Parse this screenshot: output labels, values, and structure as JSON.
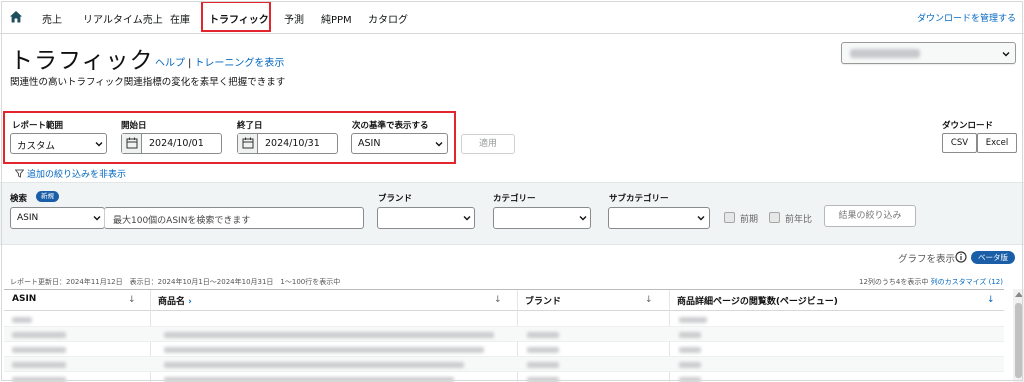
{
  "nav": {
    "items": [
      "売上",
      "リアルタイム売上",
      "在庫",
      "トラフィック",
      "予測",
      "純PPM",
      "カタログ"
    ],
    "active_index": 3,
    "manage_downloads": "ダウンロードを管理する"
  },
  "header": {
    "title": "トラフィック",
    "help_link": "ヘルプ",
    "separator": "|",
    "training_link": "トレーニングを表示",
    "subtitle": "関連性の高いトラフィック関連指標の変化を素早く把握できます"
  },
  "report": {
    "range_label": "レポート範囲",
    "range_value": "カスタム",
    "start_label": "開始日",
    "start_value": "2024/10/01",
    "end_label": "終了日",
    "end_value": "2024/10/31",
    "view_by_label": "次の基準で表示する",
    "view_by_value": "ASIN",
    "apply_label": "適用"
  },
  "download": {
    "label": "ダウンロード",
    "csv": "CSV",
    "excel": "Excel"
  },
  "filters": {
    "toggle_label": "追加の絞り込みを非表示",
    "search_label": "検索",
    "new_badge": "新規",
    "search_type": "ASIN",
    "search_placeholder": "最大100個のASINを検索できます",
    "brand_label": "ブランド",
    "category_label": "カテゴリー",
    "subcategory_label": "サブカテゴリー",
    "prev_period_label": "前期",
    "prev_year_label": "前年比",
    "narrow_results_label": "結果の絞り込み"
  },
  "graph": {
    "show_label": "グラフを表示",
    "beta_label": "ベータ版"
  },
  "meta": {
    "report_info": "レポート更新日：2024年11月12日　表示日：2024年10月1日〜2024年10月31日　1〜100行を表示中",
    "columns_info": "12列のうち4を表示中",
    "customize_columns": "列のカスタマイズ (12)"
  },
  "table": {
    "headers": [
      "ASIN",
      "商品名",
      "ブランド",
      "商品詳細ページの閲覧数(ページビュー)"
    ],
    "product_arrow": "›",
    "sort_symbol": "↓"
  },
  "colors": {
    "highlight": "#e3262e",
    "link": "#0066c0",
    "badge": "#1a5ea8"
  },
  "icons": [
    "home-icon",
    "calendar-icon",
    "chevron-down-icon",
    "filter-icon",
    "info-icon",
    "sort-arrow-icon"
  ]
}
